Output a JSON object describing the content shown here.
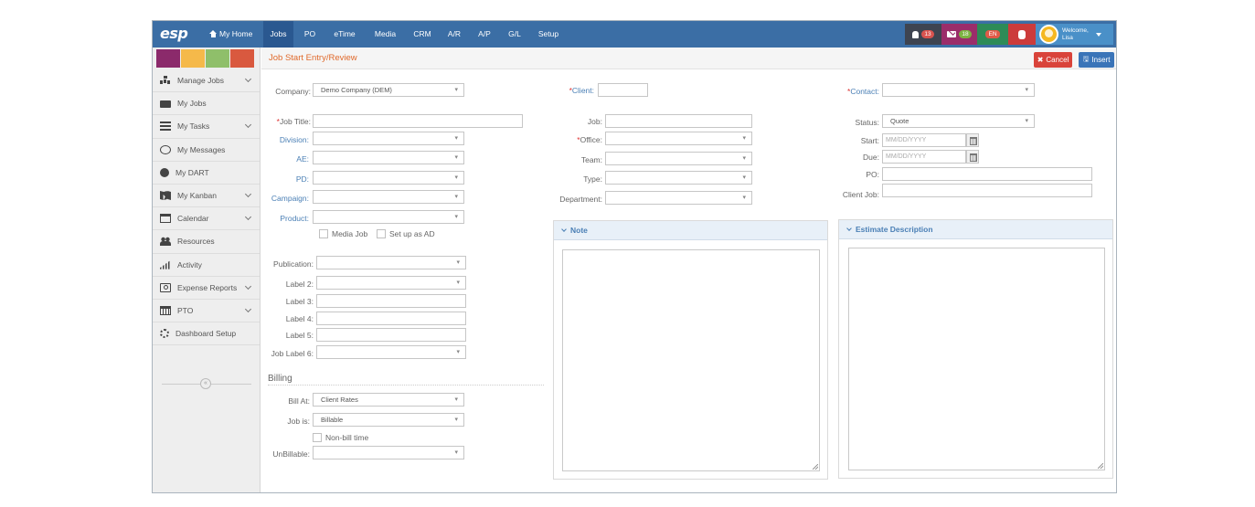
{
  "topnav": {
    "logo": "esp",
    "my_home": "My Home",
    "tabs": [
      "Jobs",
      "PO",
      "eTime",
      "Media",
      "CRM",
      "A/R",
      "A/P",
      "G/L",
      "Setup"
    ],
    "active_tab": "Jobs",
    "notifications_count": "13",
    "messages_count": "18",
    "language": "EN",
    "welcome_line1": "Welcome,",
    "welcome_line2": "Lisa"
  },
  "colors": {
    "nav_bg": "#3b6ea5",
    "swatches": [
      "#8b2a6b",
      "#f5b94a",
      "#8fbf6a",
      "#d9593f"
    ],
    "accent_title": "#e06a2c",
    "cancel": "#d9433a",
    "insert": "#3a74b8"
  },
  "sidebar": {
    "items": [
      {
        "label": "Manage Jobs",
        "icon": "sitemap-icon",
        "expandable": true
      },
      {
        "label": "My Jobs",
        "icon": "folder-open-icon",
        "expandable": false
      },
      {
        "label": "My Tasks",
        "icon": "tasks-icon",
        "expandable": true
      },
      {
        "label": "My Messages",
        "icon": "comments-icon",
        "expandable": false
      },
      {
        "label": "My DART",
        "icon": "arrow-circle-icon",
        "expandable": false
      },
      {
        "label": "My Kanban",
        "icon": "map-icon",
        "expandable": true
      },
      {
        "label": "Calendar",
        "icon": "calendar-icon",
        "expandable": true
      },
      {
        "label": "Resources",
        "icon": "users-icon",
        "expandable": false
      },
      {
        "label": "Activity",
        "icon": "signal-icon",
        "expandable": false
      },
      {
        "label": "Expense Reports",
        "icon": "money-icon",
        "expandable": true
      },
      {
        "label": "PTO",
        "icon": "calendar-grid-icon",
        "expandable": true
      },
      {
        "label": "Dashboard Setup",
        "icon": "cogs-icon",
        "expandable": false
      }
    ],
    "collapse_glyph": "«"
  },
  "header": {
    "title": "Job Start Entry/Review",
    "cancel_label": "Cancel",
    "insert_label": "Insert"
  },
  "form": {
    "company_label": "Company:",
    "company_value": "Demo Company (DEM)",
    "job_title_label": "Job Title:",
    "division_label": "Division:",
    "ae_label": "AE:",
    "pd_label": "PD:",
    "campaign_label": "Campaign:",
    "product_label": "Product:",
    "media_job_label": "Media Job",
    "setup_ad_label": "Set up as AD",
    "publication_label": "Publication:",
    "label2": "Label 2:",
    "label3": "Label 3:",
    "label4": "Label 4:",
    "label5": "Label 5:",
    "job_label6": "Job Label 6:",
    "client_label": "Client:",
    "job_label": "Job:",
    "office_label": "Office:",
    "team_label": "Team:",
    "type_label": "Type:",
    "department_label": "Department:",
    "contact_label": "Contact:",
    "status_label": "Status:",
    "status_value": "Quote",
    "start_label": "Start:",
    "due_label": "Due:",
    "date_placeholder": "MM/DD/YYYY",
    "po_label": "PO:",
    "client_job_label": "Client Job:"
  },
  "billing": {
    "title": "Billing",
    "bill_at_label": "Bill At:",
    "bill_at_value": "Client Rates",
    "job_is_label": "Job is:",
    "job_is_value": "Billable",
    "non_bill_label": "Non-bill time",
    "unbillable_label": "UnBillable:"
  },
  "panels": {
    "note_title": "Note",
    "estimate_title": "Estimate Description"
  }
}
